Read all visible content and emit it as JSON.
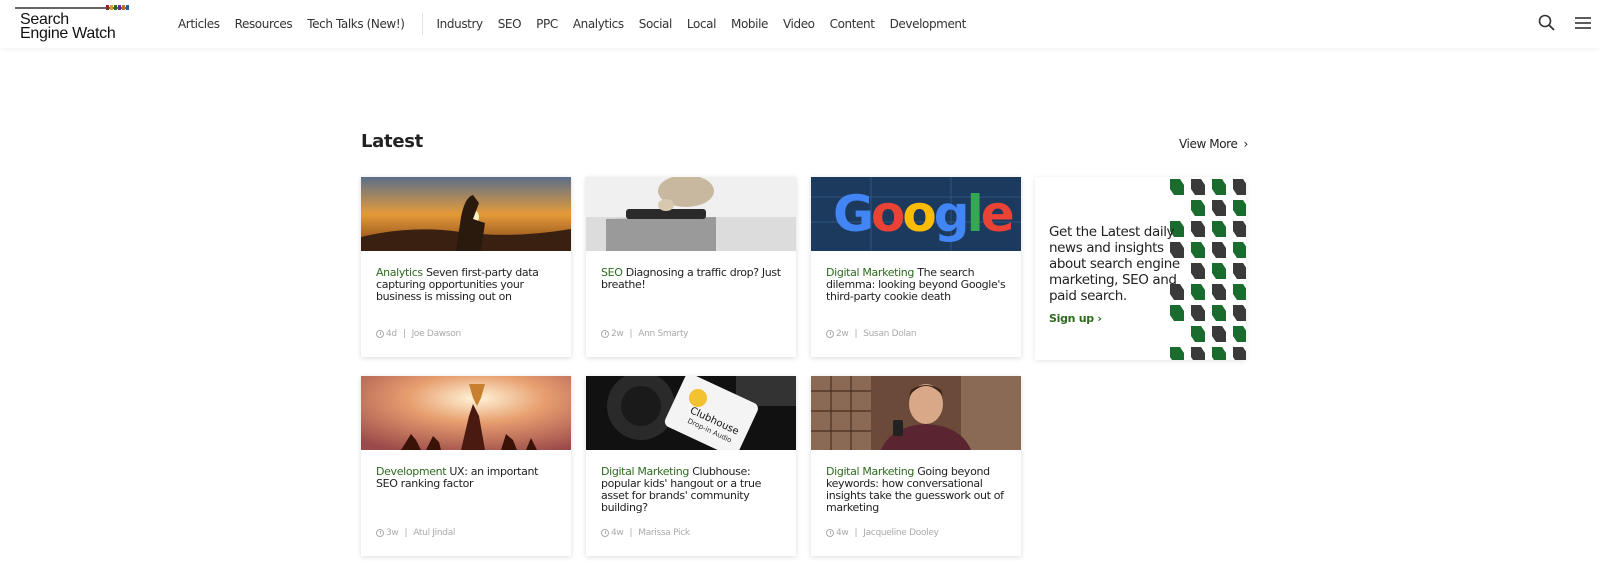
{
  "brand": {
    "logo_line1": "Search",
    "logo_line2": "Engine Watch",
    "accent_colors": [
      "#8b2a2a",
      "#c9a227",
      "#2d6a1e",
      "#6a2d8b",
      "#d46a1e",
      "#1e5fa8"
    ]
  },
  "nav": {
    "primary": [
      "Articles",
      "Resources",
      "Tech Talks (New!)"
    ],
    "categories": [
      "Industry",
      "SEO",
      "PPC",
      "Analytics",
      "Social",
      "Local",
      "Mobile",
      "Video",
      "Content",
      "Development"
    ],
    "icons": [
      "search-icon",
      "menu-icon"
    ]
  },
  "latest": {
    "title": "Latest",
    "view_more": "View More",
    "articles": [
      {
        "category": "Analytics",
        "title": "Seven first-party data capturing opportunities your business is missing out on",
        "age": "4d",
        "author": "Joe Dawson",
        "image": "hand-sunset"
      },
      {
        "category": "SEO",
        "title": "Diagnosing a traffic drop? Just breathe!",
        "age": "2w",
        "author": "Ann Smarty",
        "image": "cat-phone"
      },
      {
        "category": "Digital Marketing",
        "title": "The search dilemma: looking beyond Google's third-party cookie death",
        "age": "2w",
        "author": "Susan Dolan",
        "image": "google-sign"
      },
      {
        "category": "Development",
        "title": "UX: an important SEO ranking factor",
        "age": "3w",
        "author": "Atul Jindal",
        "image": "trophy-hands"
      },
      {
        "category": "Digital Marketing",
        "title": "Clubhouse: popular kids' hangout or a true asset for brands' community building?",
        "age": "4w",
        "author": "Marissa Pick",
        "image": "clubhouse-phone"
      },
      {
        "category": "Digital Marketing",
        "title": "Going beyond keywords: how conversational insights take the guesswork out of marketing",
        "age": "4w",
        "author": "Jacqueline Dooley",
        "image": "man-phone"
      }
    ]
  },
  "promo": {
    "text": "Get the Latest daily news and insights about search engine marketing, SEO and paid search.",
    "cta": "Sign up",
    "pattern_colors": [
      "#1a6b2e",
      "#3a3a3a"
    ]
  },
  "thumb_text": {
    "google": "Google",
    "clubhouse_line1": "Clubhouse",
    "clubhouse_line2": "Drop-in Audio"
  }
}
